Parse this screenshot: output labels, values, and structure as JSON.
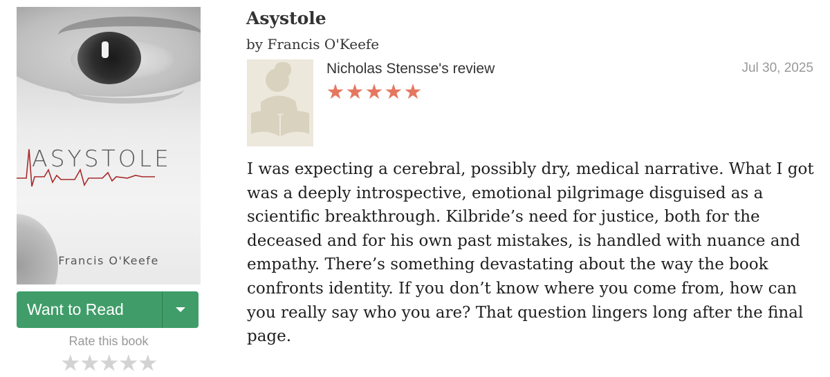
{
  "book": {
    "cover": {
      "title_text": "ASYSTOLE",
      "author_text": "Francis O'Keefe"
    },
    "want_to_read_label": "Want to Read",
    "rate_label": "Rate this book",
    "rating_stars_total": 5,
    "title": "Asystole",
    "by_label": "by",
    "author": "Francis O'Keefe"
  },
  "review": {
    "reviewer_name": "Nicholas Stensse",
    "reviewer_suffix": "'s review",
    "rating": 5,
    "date": "Jul 30, 2025",
    "text": "I was expecting a cerebral, possibly dry, medical narrative. What I got was a deeply introspective, emotional pilgrimage disguised as a scientific breakthrough. Kilbride’s need for justice, both for the deceased and for his own past mistakes, is handled with nuance and empathy. There’s something devastating about the way the book confronts identity. If you don’t know where you come from, how can you really say who you are? That question lingers long after the final page."
  },
  "colors": {
    "want_to_read_green": "#409d69",
    "review_star": "#e5775f",
    "empty_star": "#d3d3d3",
    "date_gray": "#999999"
  },
  "icons": {
    "dropdown": "caret-down-icon",
    "avatar": "reader-avatar-icon",
    "star": "star-icon"
  }
}
